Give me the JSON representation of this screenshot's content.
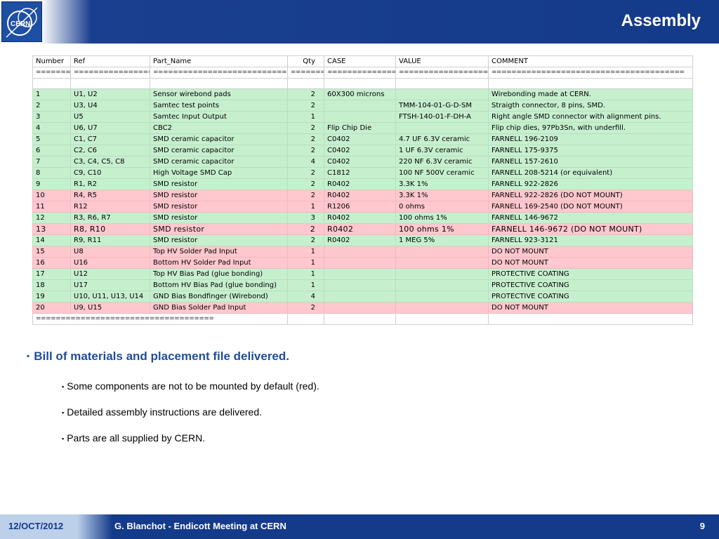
{
  "header": {
    "title": "Assembly",
    "logo_text": "CERN"
  },
  "table": {
    "columns": [
      "Number",
      "Ref",
      "Part_Name",
      "Qty",
      "CASE",
      "VALUE",
      "COMMENT"
    ],
    "separator": [
      "========",
      "==================",
      "==============================",
      "========",
      "================",
      "=====================",
      "======================================="
    ],
    "rows": [
      {
        "status": "ok",
        "cells": [
          "1",
          "U1, U2",
          "Sensor wirebond pads",
          "2",
          "60X300 microns",
          "",
          "Wirebonding made at CERN."
        ]
      },
      {
        "status": "ok",
        "cells": [
          "2",
          "U3, U4",
          "Samtec test points",
          "2",
          "",
          "TMM-104-01-G-D-SM",
          "Straigth connector, 8 pins, SMD."
        ]
      },
      {
        "status": "ok",
        "cells": [
          "3",
          "U5",
          "Samtec Input Output",
          "1",
          "",
          "FTSH-140-01-F-DH-A",
          "Right angle SMD connector with alignment pins."
        ]
      },
      {
        "status": "ok",
        "cells": [
          "4",
          "U6, U7",
          "CBC2",
          "2",
          "Flip Chip Die",
          "",
          "Flip chip dies, 97Pb3Sn, with underfill."
        ]
      },
      {
        "status": "ok",
        "cells": [
          "5",
          "C1, C7",
          "SMD ceramic capacitor",
          "2",
          "C0402",
          "4.7 UF 6.3V ceramic",
          "FARNELL 196-2109"
        ]
      },
      {
        "status": "ok",
        "cells": [
          "6",
          "C2, C6",
          "SMD ceramic capacitor",
          "2",
          "C0402",
          "1 UF 6.3V ceramic",
          "FARNELL 175-9375"
        ]
      },
      {
        "status": "ok",
        "cells": [
          "7",
          "C3, C4, C5, C8",
          "SMD ceramic capacitor",
          "4",
          "C0402",
          "220 NF 6.3V ceramic",
          "FARNELL 157-2610"
        ]
      },
      {
        "status": "ok",
        "cells": [
          "8",
          "C9, C10",
          "High Voltage SMD Cap",
          "2",
          "C1812",
          "100 NF 500V ceramic",
          "FARNELL 208-5214 (or equivalent)"
        ]
      },
      {
        "status": "ok",
        "cells": [
          "9",
          "R1, R2",
          "SMD resistor",
          "2",
          "R0402",
          "3.3K 1%",
          "FARNELL  922-2826"
        ]
      },
      {
        "status": "dnm",
        "cells": [
          "10",
          "R4, R5",
          "SMD resistor",
          "2",
          "R0402",
          "3.3K 1%",
          "FARNELL  922-2826 (DO NOT MOUNT)"
        ]
      },
      {
        "status": "dnm",
        "cells": [
          "11",
          "R12",
          "SMD resistor",
          "1",
          "R1206",
          "0 ohms",
          "FARNELL 169-2540 (DO NOT MOUNT)"
        ]
      },
      {
        "status": "ok",
        "cells": [
          "12",
          "R3, R6, R7",
          "SMD resistor",
          "3",
          "R0402",
          "100 ohms 1%",
          "FARNELL 146-9672"
        ]
      },
      {
        "status": "dnm-big",
        "cells": [
          "13",
          "R8, R10",
          "SMD resistor",
          "2",
          "R0402",
          "100 ohms  1%",
          "FARNELL 146-9672 (DO NOT MOUNT)"
        ]
      },
      {
        "status": "ok",
        "cells": [
          "14",
          "R9, R11",
          "SMD resistor",
          "2",
          "R0402",
          "1 MEG 5%",
          "FARNELL 923-3121"
        ]
      },
      {
        "status": "dnm",
        "cells": [
          "15",
          "U8",
          "Top HV Solder Pad Input",
          "1",
          "",
          "",
          "DO NOT MOUNT"
        ]
      },
      {
        "status": "dnm",
        "cells": [
          "16",
          "U16",
          "Bottom HV Solder Pad Input",
          "1",
          "",
          "",
          "DO NOT MOUNT"
        ]
      },
      {
        "status": "ok",
        "cells": [
          "17",
          "U12",
          "Top HV Bias Pad (glue bonding)",
          "1",
          "",
          "",
          "PROTECTIVE COATING"
        ]
      },
      {
        "status": "ok",
        "cells": [
          "18",
          "U17",
          "Bottom HV Bias Pad (glue bonding)",
          "1",
          "",
          "",
          "PROTECTIVE COATING"
        ]
      },
      {
        "status": "ok",
        "cells": [
          "19",
          "U10, U11, U13, U14",
          "GND Bias Bondfinger (Wirebond)",
          "4",
          "",
          "",
          "PROTECTIVE COATING"
        ]
      },
      {
        "status": "dnm",
        "cells": [
          "20",
          "U9, U15",
          "GND Bias Solder Pad Input",
          "2",
          "",
          "",
          "DO NOT MOUNT"
        ]
      }
    ],
    "footer_separator": "===================================="
  },
  "bullets": {
    "main": "Bill of materials and placement file delivered.",
    "sub": [
      "Some components are not to be mounted by default (red).",
      "Detailed assembly instructions are delivered.",
      "Parts are all supplied by CERN."
    ]
  },
  "footer": {
    "date": "12/OCT/2012",
    "text": "G. Blanchot - Endicott Meeting at CERN",
    "page": "9"
  },
  "colors": {
    "header_blue": "#143a8a",
    "row_green": "#c6efce",
    "row_red": "#ffc7ce",
    "bullet_blue": "#1f4e9c"
  }
}
